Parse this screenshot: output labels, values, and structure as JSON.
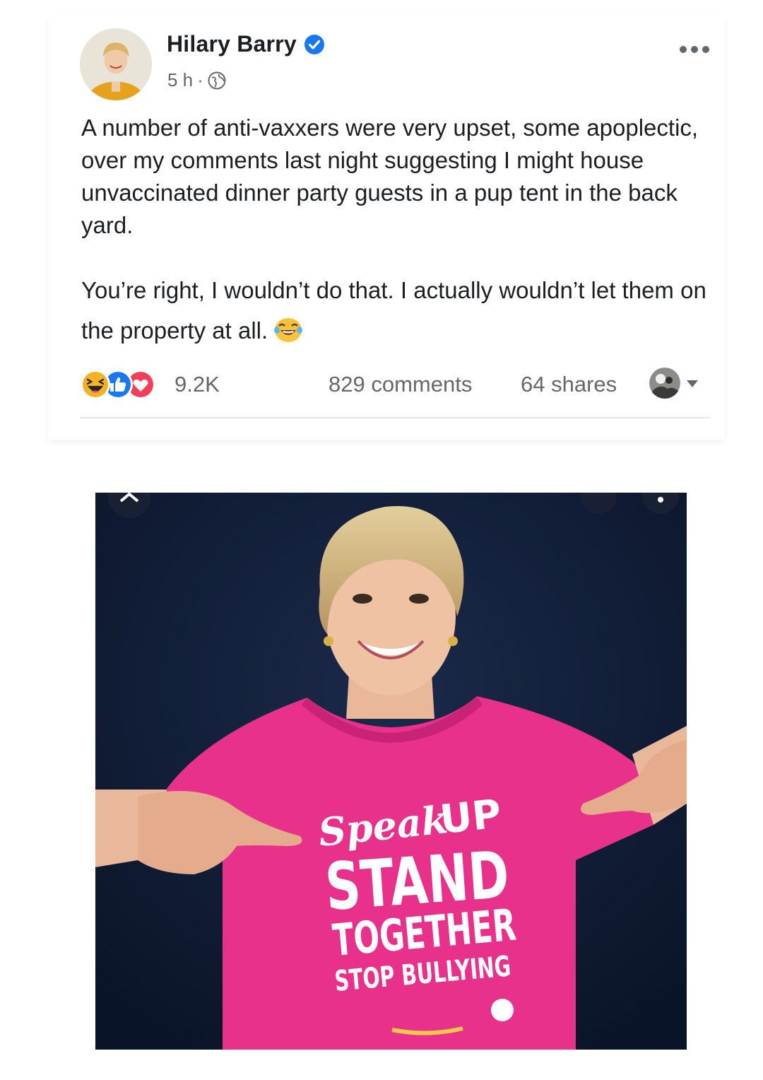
{
  "post": {
    "author_name": "Hilary Barry",
    "timestamp": "5 h",
    "meta_separator": "·",
    "paragraph_1": "A number of anti-vaxxers were very upset, some apoplectic, over my comments last night suggesting I might house unvaccinated dinner party guests in a pup tent in the back yard.",
    "paragraph_2": "You’re right, I wouldn’t do that. I actually wouldn’t let them on the property at all.",
    "reactions_count": "9.2K",
    "comments_count": "829 comments",
    "shares_count": "64 shares",
    "icons": {
      "verified": "verified-badge-icon",
      "privacy": "globe-icon",
      "more": "more-options-icon",
      "reaction_types": [
        "haha",
        "like",
        "love"
      ],
      "inline_emoji": "laughing-tears-emoji"
    }
  },
  "photo": {
    "description_alt": "Woman in pink t-shirt pointing to shirt print",
    "shirt_text": {
      "line_1a": "Speak",
      "line_1b": "UP",
      "line_2": "STAND",
      "line_3": "TOGETHER",
      "line_4": "STOP BULLYING"
    }
  },
  "colors": {
    "facebook_blue": "#1877f2",
    "love_red": "#f33e58",
    "haha_yellow": "#f7b125",
    "muted_text": "#65676b",
    "shirt_pink": "#e8318a",
    "photo_background": "#0f1b33"
  }
}
